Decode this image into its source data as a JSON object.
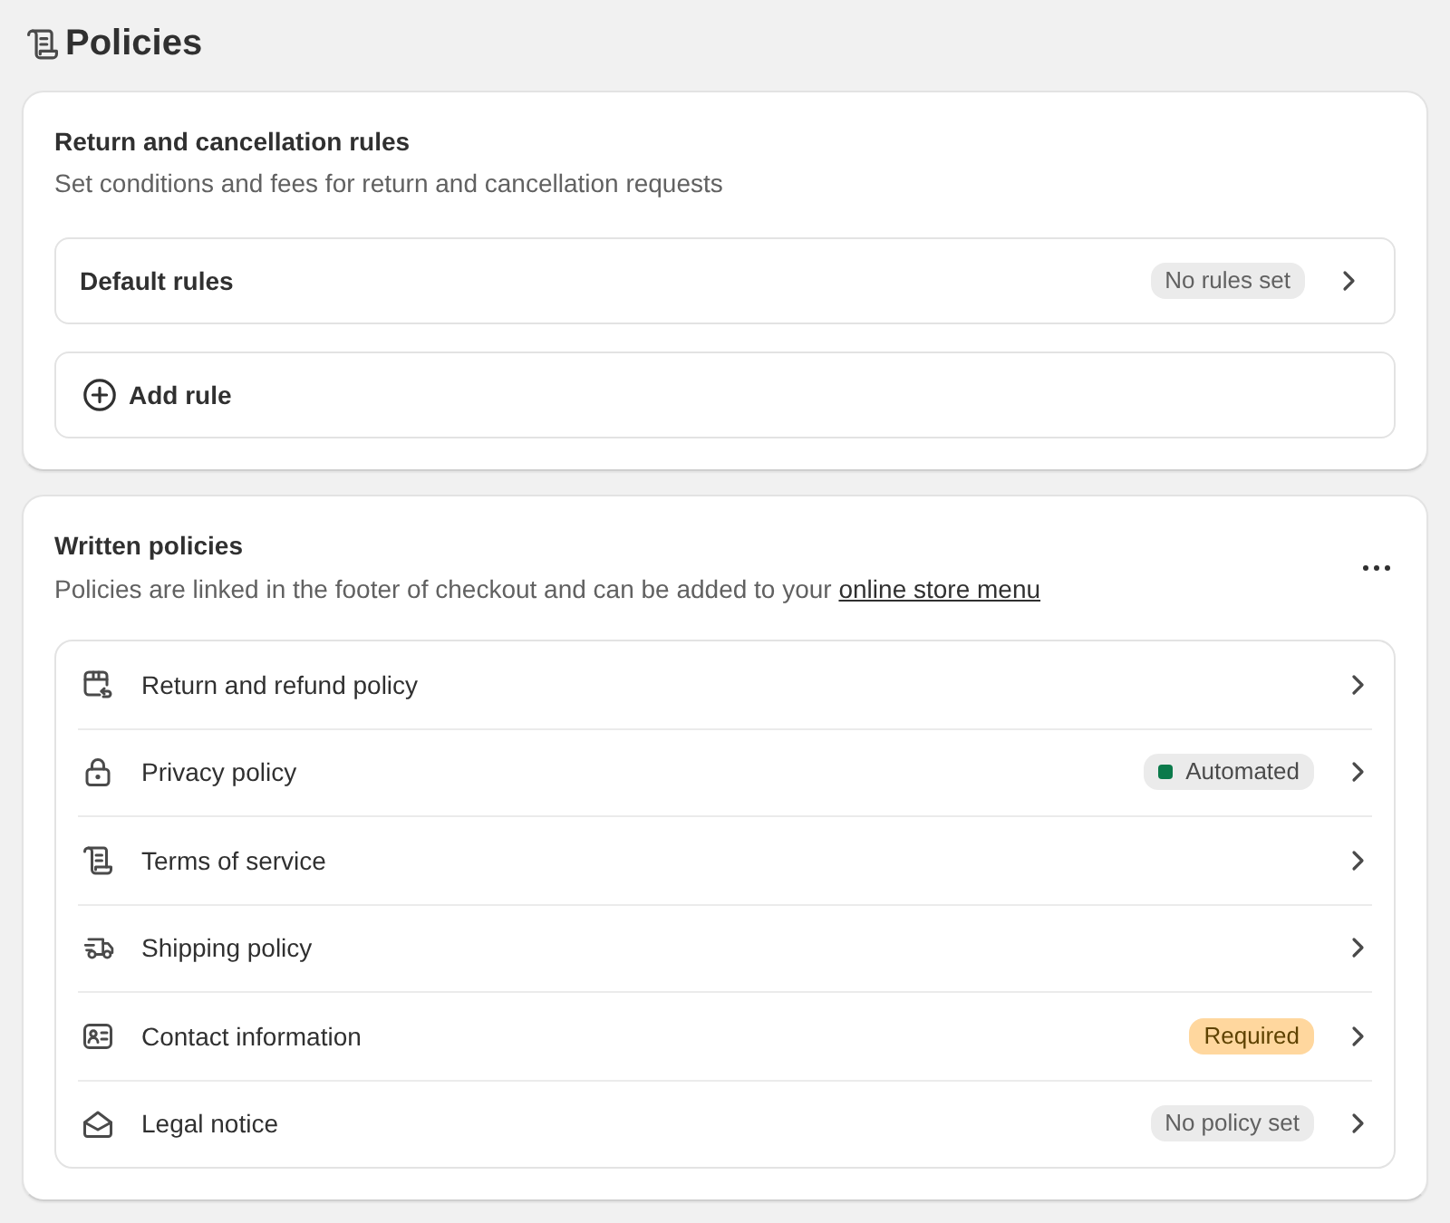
{
  "page": {
    "title": "Policies"
  },
  "rules_card": {
    "title": "Return and cancellation rules",
    "subtitle": "Set conditions and fees for return and cancellation requests",
    "items": [
      {
        "kind": "link",
        "label": "Default rules",
        "badge": {
          "text": "No rules set",
          "kind": "neutral"
        }
      },
      {
        "kind": "add",
        "label": "Add rule"
      }
    ]
  },
  "policies_card": {
    "title": "Written policies",
    "subtitle": "Policies are linked in the footer of checkout and can be added to your",
    "subtitle_link": "online store menu",
    "items": [
      {
        "label": "Return and refund policy"
      },
      {
        "label": "Privacy policy",
        "badge": {
          "text": "Automated",
          "kind": "success"
        }
      },
      {
        "label": "Terms of service"
      },
      {
        "label": "Shipping policy"
      },
      {
        "label": "Contact information",
        "badge": {
          "text": "Required",
          "kind": "attention"
        }
      },
      {
        "label": "Legal notice",
        "badge": {
          "text": "No policy set",
          "kind": "neutral"
        }
      }
    ]
  }
}
